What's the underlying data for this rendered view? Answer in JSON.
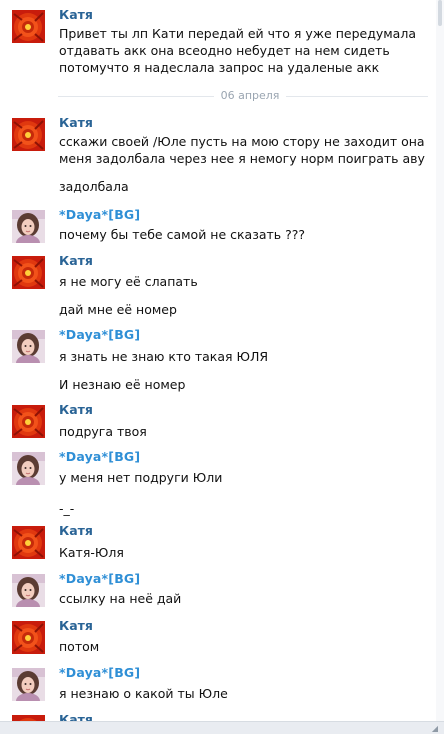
{
  "conversation": {
    "date_divider": "06 апреля",
    "messages": [
      {
        "author": "Катя",
        "avatar": "flower",
        "lines": [
          "Привет ты лп Кати передай ей что я уже передумала отдавать акк она всеодно небудет на нем сидеть потомучто я надеслала запрос на удаленые акк"
        ]
      },
      {
        "author": "Катя",
        "avatar": "flower",
        "lines": [
          "сскажи своей /Юле пусть на мою стору не заходит она меня задолбала через нее я немогу норм поиграть аву",
          "задолбала"
        ]
      },
      {
        "author": "*Daya*[BG]",
        "avatar": "girl",
        "lines": [
          "почему бы тебе самой не сказать ???"
        ]
      },
      {
        "author": "Катя",
        "avatar": "flower",
        "lines": [
          "я не могу её слапать",
          "дай мне её номер"
        ]
      },
      {
        "author": "*Daya*[BG]",
        "avatar": "girl",
        "lines": [
          "я знать не знаю кто такая ЮЛЯ",
          "И незнаю её номер"
        ]
      },
      {
        "author": "Катя",
        "avatar": "flower",
        "lines": [
          "подруга твоя"
        ]
      },
      {
        "author": "*Daya*[BG]",
        "avatar": "girl",
        "lines": [
          "у меня нет подруги Юли",
          "-_-"
        ]
      },
      {
        "author": "Катя",
        "avatar": "flower",
        "lines": [
          "Катя-Юля"
        ]
      },
      {
        "author": "*Daya*[BG]",
        "avatar": "girl",
        "lines": [
          "ссылку на неё дай"
        ]
      },
      {
        "author": "Катя",
        "avatar": "flower",
        "lines": [
          "потом"
        ]
      },
      {
        "author": "*Daya*[BG]",
        "avatar": "girl",
        "lines": [
          "я незнаю о какой ты Юле"
        ]
      },
      {
        "author": "Катя",
        "avatar": "flower",
        "lines": []
      }
    ]
  },
  "colors": {
    "author_katya": "#2a6496",
    "author_daya": "#2f8fd6",
    "divider_text": "#9aa5b1"
  }
}
